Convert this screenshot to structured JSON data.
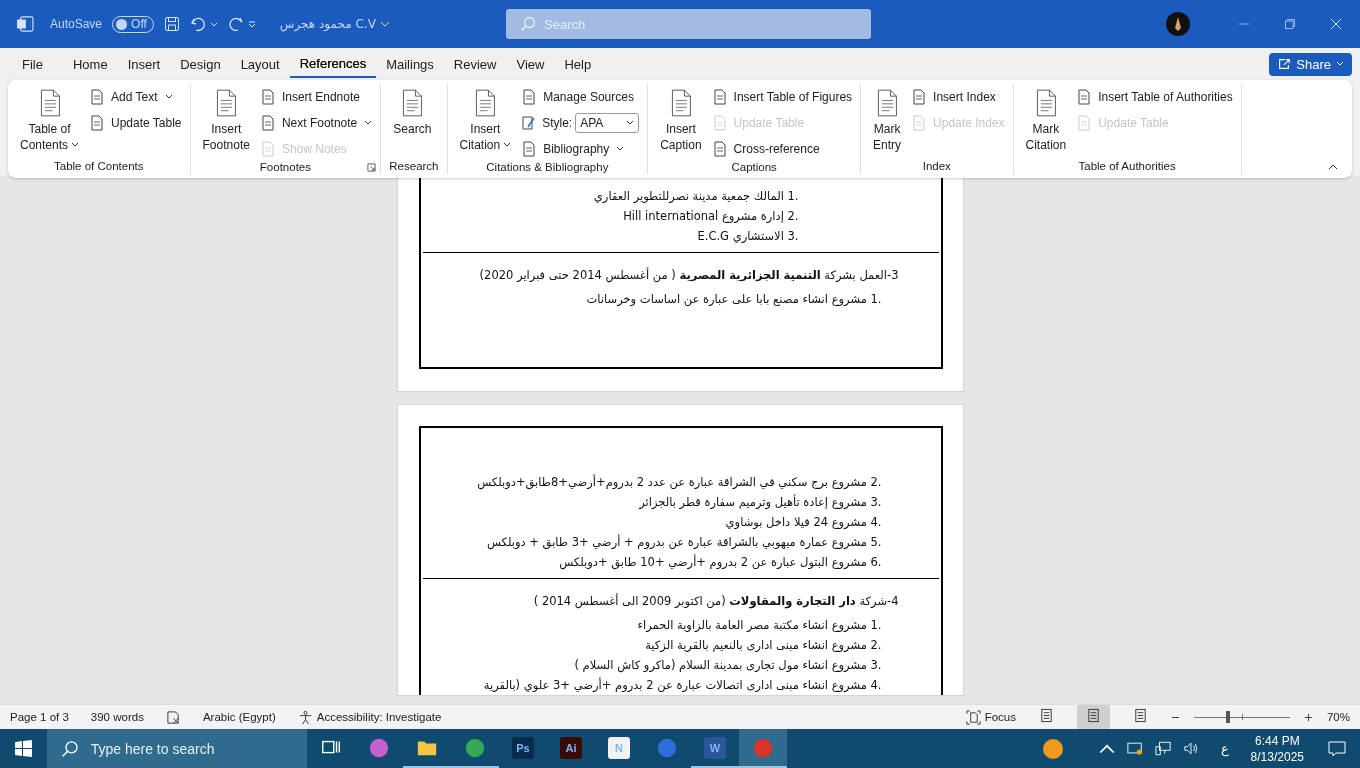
{
  "title_bar": {
    "autosave_label": "AutoSave",
    "autosave": {
      "on": false,
      "label": "Off"
    },
    "document_title": "محمود هجرس C.V",
    "search": {
      "placeholder": "Search"
    }
  },
  "menu_tabs": [
    {
      "label": "File",
      "selected": false
    },
    {
      "label": "Home",
      "selected": false
    },
    {
      "label": "Insert",
      "selected": false
    },
    {
      "label": "Design",
      "selected": false
    },
    {
      "label": "Layout",
      "selected": false
    },
    {
      "label": "References",
      "selected": true
    },
    {
      "label": "Mailings",
      "selected": false
    },
    {
      "label": "Review",
      "selected": false
    },
    {
      "label": "View",
      "selected": false
    },
    {
      "label": "Help",
      "selected": false
    }
  ],
  "share": {
    "label": "Share"
  },
  "ribbon": [
    {
      "label": "Table of Contents",
      "launcher": false,
      "large": [
        {
          "lines": [
            "Table of",
            "Contents"
          ],
          "dropdown": true
        }
      ],
      "small": [
        {
          "kind": "command",
          "label": "Add Text",
          "dropdown": true,
          "disabled": false
        },
        {
          "kind": "command",
          "label": "Update Table",
          "dropdown": false,
          "disabled": false
        }
      ]
    },
    {
      "label": "Footnotes",
      "launcher": true,
      "large": [
        {
          "lines": [
            "Insert",
            "Footnote"
          ],
          "dropdown": false
        }
      ],
      "small": [
        {
          "kind": "command",
          "label": "Insert Endnote",
          "dropdown": false,
          "disabled": false
        },
        {
          "kind": "command",
          "label": "Next Footnote",
          "dropdown": true,
          "disabled": false
        },
        {
          "kind": "command",
          "label": "Show Notes",
          "dropdown": false,
          "disabled": true
        }
      ]
    },
    {
      "label": "Research",
      "launcher": false,
      "large": [
        {
          "lines": [
            "Search"
          ],
          "dropdown": false
        }
      ]
    },
    {
      "label": "Citations & Bibliography",
      "launcher": false,
      "large": [
        {
          "lines": [
            "Insert",
            "Citation"
          ],
          "dropdown": true
        }
      ],
      "small": [
        {
          "kind": "command",
          "label": "Manage Sources",
          "dropdown": false,
          "disabled": false
        },
        {
          "kind": "select",
          "label": "Style:",
          "value": "APA"
        },
        {
          "kind": "command",
          "label": "Bibliography",
          "dropdown": true,
          "disabled": false
        }
      ]
    },
    {
      "label": "Captions",
      "launcher": false,
      "large": [
        {
          "lines": [
            "Insert",
            "Caption"
          ],
          "dropdown": false
        }
      ],
      "small": [
        {
          "kind": "command",
          "label": "Insert Table of Figures",
          "dropdown": false,
          "disabled": false
        },
        {
          "kind": "command",
          "label": "Update Table",
          "dropdown": false,
          "disabled": true
        },
        {
          "kind": "command",
          "label": "Cross-reference",
          "dropdown": false,
          "disabled": false
        }
      ]
    },
    {
      "label": "Index",
      "launcher": false,
      "large": [
        {
          "lines": [
            "Mark",
            "Entry"
          ],
          "dropdown": false
        }
      ],
      "small": [
        {
          "kind": "command",
          "label": "Insert Index",
          "dropdown": false,
          "disabled": false
        },
        {
          "kind": "command",
          "label": "Update Index",
          "dropdown": false,
          "disabled": true
        }
      ]
    },
    {
      "label": "Table of Authorities",
      "launcher": false,
      "large": [
        {
          "lines": [
            "Mark",
            "Citation"
          ],
          "dropdown": false
        }
      ],
      "small": [
        {
          "kind": "command",
          "label": "Insert Table of Authorities",
          "dropdown": false,
          "disabled": false
        },
        {
          "kind": "command",
          "label": "Update Table",
          "dropdown": false,
          "disabled": true
        }
      ]
    }
  ],
  "document": {
    "pages": [
      {
        "blocks": [
          {
            "kind": "subitem",
            "number": "1.",
            "text": "المالك جمعية مدينة نصرللتطوير العقاري"
          },
          {
            "kind": "subitem",
            "number": "2.",
            "text": "إدارة مشروع Hill international"
          },
          {
            "kind": "subitem",
            "number": "3.",
            "text": "الاستشاري E.C.G"
          },
          {
            "kind": "rule"
          },
          {
            "kind": "heading",
            "text": "3-العمل بشركة **التنمية الجزائرية المصرية** ( من أغسطس 2014 حتى فبراير 2020)"
          },
          {
            "kind": "item",
            "number": "1.",
            "text": "مشروع انشاء مصنع بابا على عبارة عن اساسات وخرسانات"
          }
        ]
      },
      {
        "blocks": [
          {
            "kind": "item",
            "number": "2.",
            "text": "مشروع برج سكني في الشراقة عبارة عن عدد 2 بدروم+أرضي+8طابق+دوبلكس"
          },
          {
            "kind": "item",
            "number": "3.",
            "text": "مشروع إعادة تأهيل وترميم سفارة قطر بالجزائر"
          },
          {
            "kind": "item",
            "number": "4.",
            "text": "مشروع 24 فيلا داخل بوشاوي"
          },
          {
            "kind": "item",
            "number": "5.",
            "text": "مشروع عمارة ميهوبي بالشراقة عبارة عن بدروم + أرضي +3 طابق + دوبلكس"
          },
          {
            "kind": "item",
            "number": "6.",
            "text": "مشروع البتول عبارة عن 2 بدروم +أرضي +10 طابق +دوبلكس"
          },
          {
            "kind": "rule"
          },
          {
            "kind": "heading",
            "text": "4-شركة **دار التجارة والمقاولات** (من اكتوبر 2009 الى أغسطس 2014 )"
          },
          {
            "kind": "item",
            "number": "1.",
            "text": "مشروع انشاء مكتبة مصر العامة بالزاوية الحمراء"
          },
          {
            "kind": "item",
            "number": "2.",
            "text": "مشروع انشاء مبنى ادارى بالنعيم بالقرية الزكية"
          },
          {
            "kind": "item",
            "number": "3.",
            "text": "مشروع انشاء مول تجارى بمدينة السلام (ماكرو كاش السلام )"
          },
          {
            "kind": "item",
            "number": "4.",
            "text": "مشروع انشاء مبنى ادارى اتصالات عبارة عن 2 بدروم +أرضي +3 علوي (بالقرية"
          }
        ]
      }
    ]
  },
  "status_bar": {
    "page": "Page 1 of 3",
    "words": "390 words",
    "language": "Arabic (Egypt)",
    "accessibility": "Accessibility: Investigate",
    "focus": "Focus",
    "views": [
      {
        "selected": false
      },
      {
        "selected": true
      },
      {
        "selected": false
      }
    ],
    "zoom": {
      "level": 0.35,
      "label": "70%"
    }
  },
  "taskbar": {
    "search_placeholder": "Type here to search",
    "apps": [
      {
        "kind": "taskview",
        "running": false,
        "selected": false
      },
      {
        "kind": "app",
        "color": "#c85fd0",
        "running": false,
        "selected": false
      },
      {
        "kind": "folder",
        "color": "#f4c542",
        "running": true,
        "selected": false
      },
      {
        "kind": "app",
        "color": "#34a853",
        "running": true,
        "selected": false
      },
      {
        "kind": "app",
        "color": "#0a2b4a",
        "glyph": "Ps",
        "running": false,
        "selected": false
      },
      {
        "kind": "app",
        "color": "#3a0a05",
        "glyph": "Ai",
        "running": false,
        "selected": false
      },
      {
        "kind": "app",
        "color": "#f2f2f2",
        "glyph": "N",
        "running": false,
        "selected": false
      },
      {
        "kind": "app",
        "color": "#2a6fdb",
        "running": false,
        "selected": false
      },
      {
        "kind": "app",
        "color": "#2b579a",
        "glyph": "W",
        "running": true,
        "selected": false
      },
      {
        "kind": "app",
        "color": "#d9352b",
        "running": true,
        "selected": true
      }
    ],
    "language": "ع",
    "time": "6:44 PM",
    "date": "8/13/2025"
  }
}
